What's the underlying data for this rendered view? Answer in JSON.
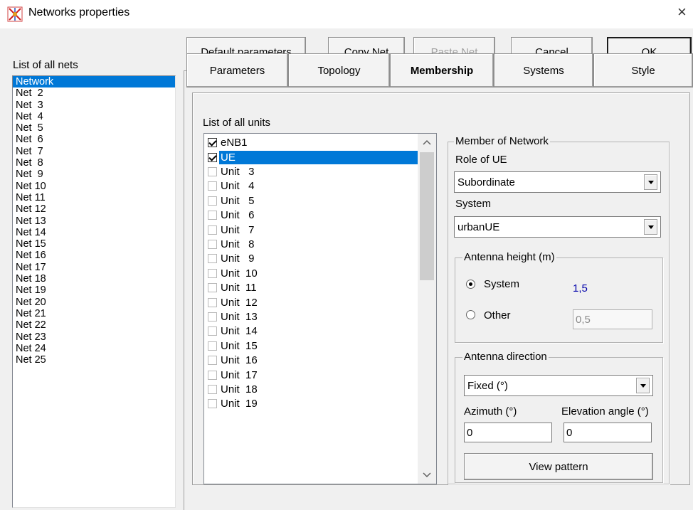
{
  "window": {
    "title": "Networks properties",
    "close_glyph": "×",
    "icon": "network-app-icon"
  },
  "nets": {
    "label": "List of all nets",
    "selected_index": 0,
    "items": [
      "Network",
      "Net  2",
      "Net  3",
      "Net  4",
      "Net  5",
      "Net  6",
      "Net  7",
      "Net  8",
      "Net  9",
      "Net 10",
      "Net 11",
      "Net 12",
      "Net 13",
      "Net 14",
      "Net 15",
      "Net 16",
      "Net 17",
      "Net 18",
      "Net 19",
      "Net 20",
      "Net 21",
      "Net 22",
      "Net 23",
      "Net 24",
      "Net 25"
    ]
  },
  "toolbar": {
    "default_params": "Default parameters",
    "copy_net": "Copy Net",
    "paste_net": "Paste Net",
    "cancel": "Cancel",
    "ok": "OK"
  },
  "tabs": {
    "active": "Membership",
    "items": [
      "Parameters",
      "Topology",
      "Membership",
      "Systems",
      "Style"
    ]
  },
  "units": {
    "label": "List of all units",
    "selected_index": 1,
    "items": [
      {
        "label": "eNB1",
        "checked": true
      },
      {
        "label": "UE",
        "checked": true
      },
      {
        "label": "Unit   3",
        "checked": false
      },
      {
        "label": "Unit   4",
        "checked": false
      },
      {
        "label": "Unit   5",
        "checked": false
      },
      {
        "label": "Unit   6",
        "checked": false
      },
      {
        "label": "Unit   7",
        "checked": false
      },
      {
        "label": "Unit   8",
        "checked": false
      },
      {
        "label": "Unit   9",
        "checked": false
      },
      {
        "label": "Unit  10",
        "checked": false
      },
      {
        "label": "Unit  11",
        "checked": false
      },
      {
        "label": "Unit  12",
        "checked": false
      },
      {
        "label": "Unit  13",
        "checked": false
      },
      {
        "label": "Unit  14",
        "checked": false
      },
      {
        "label": "Unit  15",
        "checked": false
      },
      {
        "label": "Unit  16",
        "checked": false
      },
      {
        "label": "Unit  17",
        "checked": false
      },
      {
        "label": "Unit  18",
        "checked": false
      },
      {
        "label": "Unit  19",
        "checked": false
      }
    ],
    "scroll_up": "^",
    "scroll_down": "v"
  },
  "member": {
    "group_title": "Member of Network",
    "role_label": "Role of UE",
    "role_value": "Subordinate",
    "system_label": "System",
    "system_value": "urbanUE",
    "antenna_height": {
      "title": "Antenna height (m)",
      "system_label": "System",
      "system_value": "1,5",
      "other_label": "Other",
      "other_value": "0,5",
      "selected": "System"
    },
    "antenna_direction": {
      "title": "Antenna direction",
      "mode_value": "Fixed (°)",
      "azimuth_label": "Azimuth (°)",
      "azimuth_value": "0",
      "elevation_label": "Elevation angle (°)",
      "elevation_value": "0",
      "view_pattern": "View pattern"
    }
  }
}
